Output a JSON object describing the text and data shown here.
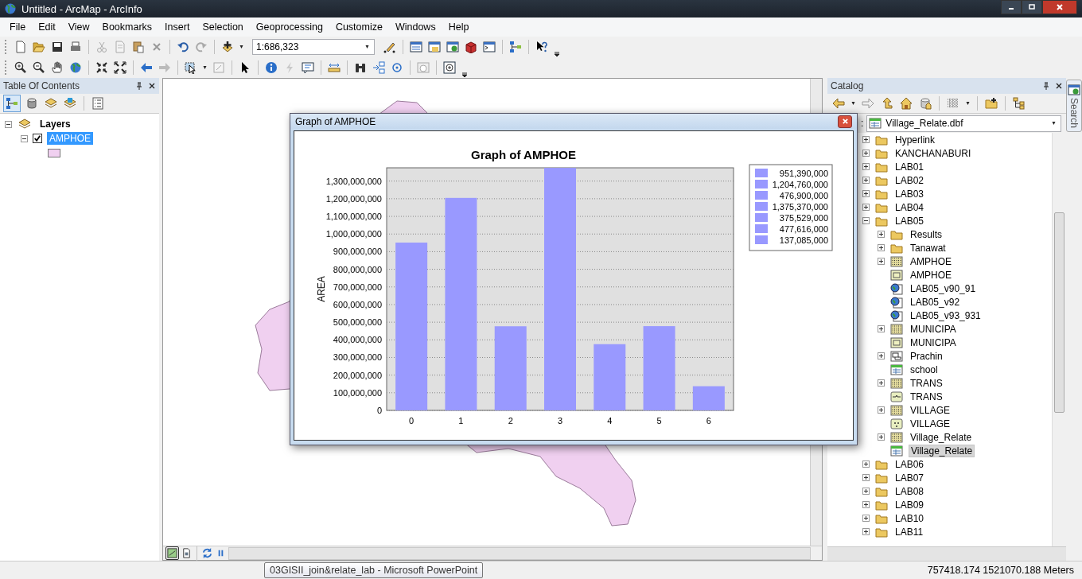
{
  "window": {
    "title": "Untitled - ArcMap - ArcInfo"
  },
  "menu": [
    "File",
    "Edit",
    "View",
    "Bookmarks",
    "Insert",
    "Selection",
    "Geoprocessing",
    "Customize",
    "Windows",
    "Help"
  ],
  "scale_field": {
    "value": "1:686,323"
  },
  "toc": {
    "title": "Table Of Contents",
    "layers": [
      {
        "label": "Layers",
        "expanded": true,
        "children": [
          {
            "label": "AMPHOE",
            "expanded": true,
            "checked": true,
            "selected": true
          }
        ]
      }
    ]
  },
  "graph_window": {
    "title": "Graph of AMPHOE",
    "legend": [
      "951,390,000",
      "1,204,760,000",
      "476,900,000",
      "1,375,370,000",
      "375,529,000",
      "477,616,000",
      "137,085,000"
    ],
    "chart_data": {
      "type": "bar",
      "title": "Graph of AMPHOE",
      "ylabel": "AREA",
      "categories": [
        "0",
        "1",
        "2",
        "3",
        "4",
        "5",
        "6"
      ],
      "grid": true,
      "series": [
        {
          "color": "#9999ff",
          "values": [
            951390000,
            1204760000,
            476900000,
            1375370000,
            375529000,
            477616000,
            137085000
          ]
        }
      ],
      "ylim": [
        0,
        1375370000
      ],
      "yticks": [
        {
          "value": 0,
          "label": "0"
        },
        {
          "value": 100000000,
          "label": "100,000,000"
        },
        {
          "value": 200000000,
          "label": "200,000,000"
        },
        {
          "value": 300000000,
          "label": "300,000,000"
        },
        {
          "value": 400000000,
          "label": "400,000,000"
        },
        {
          "value": 500000000,
          "label": "500,000,000"
        },
        {
          "value": 600000000,
          "label": "600,000,000"
        },
        {
          "value": 700000000,
          "label": "700,000,000"
        },
        {
          "value": 800000000,
          "label": "800,000,000"
        },
        {
          "value": 900000000,
          "label": "900,000,000"
        },
        {
          "value": 1000000000,
          "label": "1,000,000,000"
        },
        {
          "value": 1100000000,
          "label": "1,100,000,000"
        },
        {
          "value": 1200000000,
          "label": "1,200,000,000"
        },
        {
          "value": 1300000000,
          "label": "1,300,000,000"
        }
      ]
    }
  },
  "catalog": {
    "title": "Catalog",
    "location_label": ":",
    "location": "Village_Relate.dbf",
    "tree": [
      {
        "label": "Hyperlink",
        "kind": "folder",
        "expanded": false,
        "selected": false
      },
      {
        "label": "KANCHANABURI",
        "kind": "folder",
        "expanded": false,
        "selected": false
      },
      {
        "label": "LAB01",
        "kind": "folder",
        "expanded": false,
        "selected": false
      },
      {
        "label": "LAB02",
        "kind": "folder",
        "expanded": false,
        "selected": false
      },
      {
        "label": "LAB03",
        "kind": "folder",
        "expanded": false,
        "selected": false
      },
      {
        "label": "LAB04",
        "kind": "folder",
        "expanded": false,
        "selected": false
      },
      {
        "label": "LAB05",
        "kind": "folder",
        "expanded": true,
        "selected": false,
        "children": [
          {
            "label": "Results",
            "kind": "folder",
            "expanded": false,
            "selected": false
          },
          {
            "label": "Tanawat",
            "kind": "folder",
            "expanded": false,
            "selected": false
          },
          {
            "label": "AMPHOE",
            "kind": "coverage",
            "expanded": false,
            "selected": false
          },
          {
            "label": "AMPHOE",
            "kind": "raster",
            "selected": false
          },
          {
            "label": "LAB05_v90_91",
            "kind": "layer_file",
            "selected": false
          },
          {
            "label": "LAB05_v92",
            "kind": "layer_file",
            "selected": false
          },
          {
            "label": "LAB05_v93_931",
            "kind": "layer_file",
            "selected": false
          },
          {
            "label": "MUNICIPA",
            "kind": "coverage",
            "expanded": false,
            "selected": false
          },
          {
            "label": "MUNICIPA",
            "kind": "raster",
            "selected": false
          },
          {
            "label": "Prachin",
            "kind": "workspace",
            "expanded": false,
            "selected": false
          },
          {
            "label": "school",
            "kind": "table",
            "selected": false
          },
          {
            "label": "TRANS",
            "kind": "coverage",
            "expanded": false,
            "selected": false
          },
          {
            "label": "TRANS",
            "kind": "line_feature",
            "selected": false
          },
          {
            "label": "VILLAGE",
            "kind": "coverage",
            "expanded": false,
            "selected": false
          },
          {
            "label": "VILLAGE",
            "kind": "point_feature",
            "selected": false
          },
          {
            "label": "Village_Relate",
            "kind": "coverage",
            "expanded": false,
            "selected": false
          },
          {
            "label": "Village_Relate",
            "kind": "table",
            "selected": true
          }
        ]
      },
      {
        "label": "LAB06",
        "kind": "folder",
        "expanded": false,
        "selected": false
      },
      {
        "label": "LAB07",
        "kind": "folder",
        "expanded": false,
        "selected": false
      },
      {
        "label": "LAB08",
        "kind": "folder",
        "expanded": false,
        "selected": false
      },
      {
        "label": "LAB09",
        "kind": "folder",
        "expanded": false,
        "selected": false
      },
      {
        "label": "LAB10",
        "kind": "folder",
        "expanded": false,
        "selected": false
      },
      {
        "label": "LAB11",
        "kind": "folder",
        "expanded": false,
        "selected": false
      }
    ]
  },
  "search_tab": {
    "label": "Search"
  },
  "tooltip": "03GISII_join&relate_lab - Microsoft PowerPoint",
  "status_bar": {
    "coordinates": "757418.174  1521070.188 Meters"
  }
}
